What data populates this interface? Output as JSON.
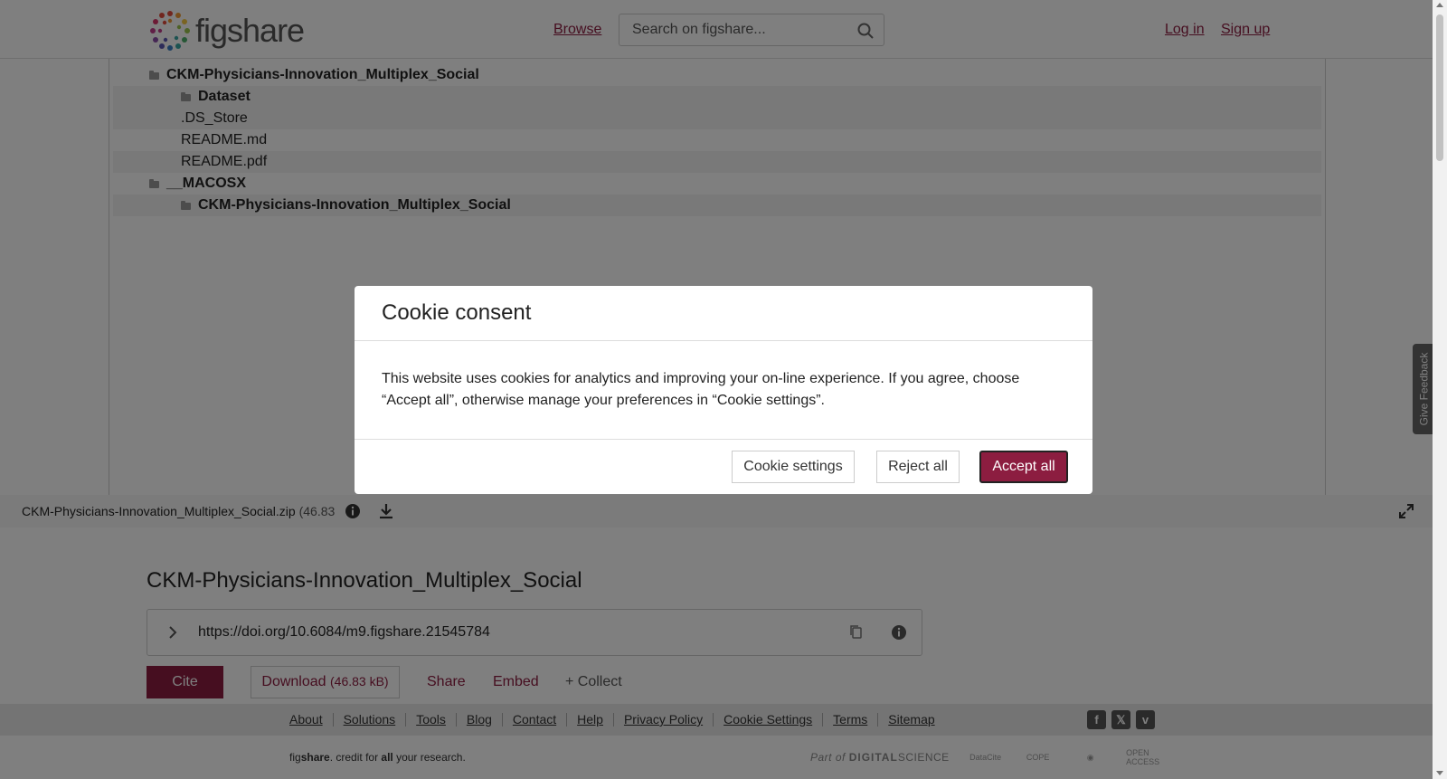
{
  "header": {
    "logo_text": "figshare",
    "browse_label": "Browse",
    "search_placeholder": "Search on figshare...",
    "login_label": "Log in",
    "signup_label": "Sign up"
  },
  "tree": [
    {
      "label": "CKM-Physicians-Innovation_Multiplex_Social",
      "type": "folder",
      "depth": 0
    },
    {
      "label": "Dataset",
      "type": "folder",
      "depth": 1
    },
    {
      "label": ".DS_Store",
      "type": "file",
      "depth": 1
    },
    {
      "label": "README.md",
      "type": "file",
      "depth": 1
    },
    {
      "label": "README.pdf",
      "type": "file",
      "depth": 1
    },
    {
      "label": "__MACOSX",
      "type": "folder",
      "depth": 0
    },
    {
      "label": "CKM-Physicians-Innovation_Multiplex_Social",
      "type": "folder",
      "depth": 1
    }
  ],
  "file_bar": {
    "file_name": "CKM-Physicians-Innovation_Multiplex_Social.zip",
    "file_size": "(46.83"
  },
  "item": {
    "title": "CKM-Physicians-Innovation_Multiplex_Social",
    "doi": "https://doi.org/10.6084/m9.figshare.21545784",
    "cite_label": "Cite",
    "download_label": "Download",
    "download_size": "(46.83 kB)",
    "share_label": "Share",
    "embed_label": "Embed",
    "collect_label": "+ Collect"
  },
  "footer": {
    "links": [
      "About",
      "Solutions",
      "Tools",
      "Blog",
      "Contact",
      "Help",
      "Privacy Policy",
      "Cookie Settings",
      "Terms",
      "Sitemap"
    ],
    "social_icons": [
      "facebook-icon",
      "x-icon",
      "vimeo-icon"
    ],
    "tagline_prefix": "fig",
    "tagline_bold": "share",
    "tagline_mid": ". credit for ",
    "tagline_all": "all",
    "tagline_end": " your research.",
    "partner_ds_prefix": "Part of",
    "partner_ds_bold": "DIGITAL",
    "partner_ds_suffix": "SCIENCE",
    "partner_datacite": "DataCite",
    "partner_cope": "COPE",
    "partner_oa": "OPEN ACCESS"
  },
  "feedback_label": "Give Feedback",
  "modal": {
    "title": "Cookie consent",
    "body": "This website uses cookies for analytics and improving your on-line experience. If you agree, choose “Accept all”, otherwise manage your preferences in “Cookie settings”.",
    "settings_label": "Cookie settings",
    "reject_label": "Reject all",
    "accept_label": "Accept all"
  },
  "colors": {
    "brand": "#8c1d40"
  }
}
